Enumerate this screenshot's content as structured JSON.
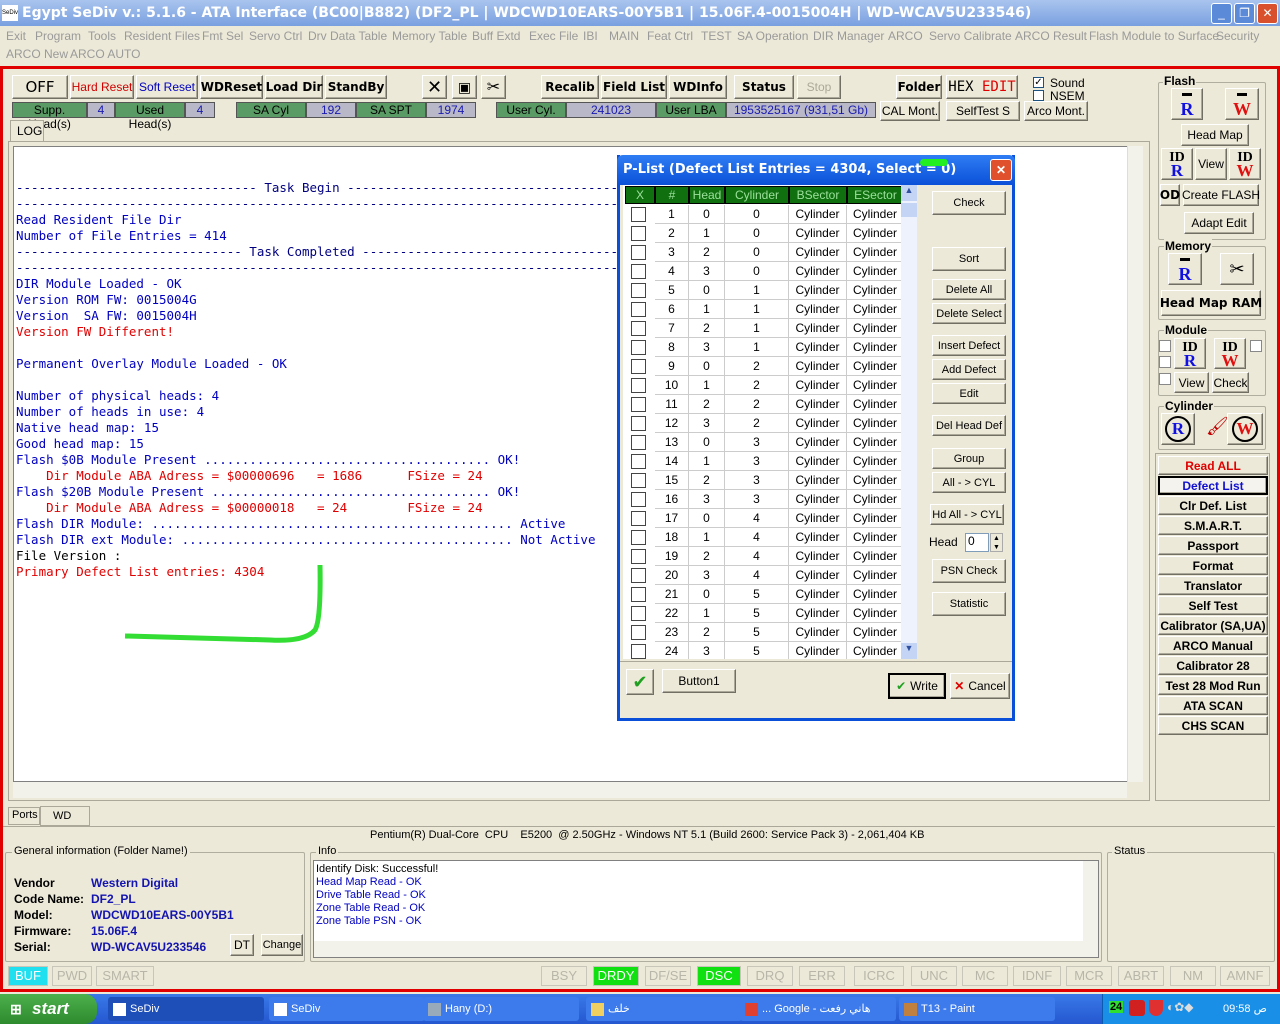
{
  "window": {
    "title": "Egypt  SeDiv v.: 5.1.6 - ATA Interface (BC00|B882)  (DF2_PL  |  WDCWD10EARS-00Y5B1  |  15.06F.4-0015004H  |  WD-WCAV5U233546)",
    "logo": "SeDiv"
  },
  "menu": [
    "Exit",
    "Program",
    "Tools",
    "Resident Files",
    "Fmt Sel",
    "Servo Ctrl",
    "Drv Data Table",
    "Memory Table",
    "Buff Extd",
    "Exec File",
    "IBI",
    "MAIN",
    "Feat Ctrl",
    "TEST",
    "SA Operation",
    "DIR Manager",
    "ARCO",
    "Servo Calibrate",
    "ARCO Result",
    "Flash Module to Surface",
    "Security",
    "ARCO New",
    "ARCO AUTO"
  ],
  "toolbar": {
    "off": "OFF",
    "hard_reset": "Hard Reset",
    "soft_reset": "Soft Reset",
    "wdreset": "WDReset",
    "load_dir": "Load Dir",
    "standby": "StandBy",
    "recalib": "Recalib",
    "field_list": "Field List",
    "wdinfo": "WDInfo",
    "status": "Status",
    "stop": "Stop",
    "folder": "Folder",
    "hex": "HEX",
    "edit": "EDIT",
    "sound": "Sound",
    "sound_checked": true,
    "nsem": "NSEM",
    "nsem_checked": false,
    "cal_mont": "CAL Mont.",
    "selftest_s": "SelfTest S",
    "arco_mont": "Arco Mont."
  },
  "info_bar": {
    "supp_heads_label": "Supp. Head(s)",
    "supp_heads": "4",
    "used_heads_label": "Used Head(s)",
    "used_heads": "4",
    "sa_cyl_label": "SA Cyl",
    "sa_cyl": "192",
    "sa_spt_label": "SA SPT",
    "sa_spt": "1974",
    "user_cyl_label": "User Cyl.",
    "user_cyl": "241023",
    "user_lba_label": "User LBA",
    "user_lba": "1953525167  (931,51 Gb)"
  },
  "log_tab": "LOG",
  "log": [
    {
      "t": "-------------------------------- Task Begin ---------------------------------------------------------------",
      "c": "#000080"
    },
    {
      "t": "-------------------------------------------------------------------------------------------------------------",
      "c": "#000080"
    },
    {
      "t": "Read Resident File Dir",
      "c": "#0000c0"
    },
    {
      "t": "Number of File Entries = 414",
      "c": "#0000c0"
    },
    {
      "t": "------------------------------ Task Completed -------------------------------------------------------------",
      "c": "#000080"
    },
    {
      "t": "-------------------------------------------------------------------------------------------------------------",
      "c": "#000080"
    },
    {
      "t": "DIR Module Loaded - OK",
      "c": "#0000c0"
    },
    {
      "t": "Version ROM FW: 0015004G",
      "c": "#0000c0"
    },
    {
      "t": "Version  SA FW: 0015004H",
      "c": "#0000c0"
    },
    {
      "t": "Version FW Different!",
      "c": "#e00000"
    },
    {
      "t": "",
      "c": "#000"
    },
    {
      "t": "Permanent Overlay Module Loaded - OK",
      "c": "#0000c0"
    },
    {
      "t": "",
      "c": "#000"
    },
    {
      "t": "Number of physical heads: 4",
      "c": "#0000c0"
    },
    {
      "t": "Number of heads in use: 4",
      "c": "#0000c0"
    },
    {
      "t": "Native head map: 15",
      "c": "#0000c0"
    },
    {
      "t": "Good head map: 15",
      "c": "#0000c0"
    },
    {
      "t": "Flash $0B Module Present ...................................... OK!",
      "c": "#0000c0"
    },
    {
      "t": "    Dir Module ABA Adress = $00000696   = 1686      FSize = 24",
      "c": "#e00000"
    },
    {
      "t": "Flash $20B Module Present ..................................... OK!",
      "c": "#0000c0"
    },
    {
      "t": "    Dir Module ABA Adress = $00000018   = 24        FSize = 24",
      "c": "#e00000"
    },
    {
      "t": "Flash DIR Module: ................................................ Active",
      "c": "#0000c0"
    },
    {
      "t": "Flash DIR ext Module: ............................................ Not Active",
      "c": "#0000c0"
    },
    {
      "t": "File Version :",
      "c": "#000000"
    },
    {
      "t": "Primary Defect List entries: 4304",
      "c": "#e00000"
    }
  ],
  "dialog": {
    "title": "P-List (Defect List Entries = 4304, Select = 0)",
    "columns": [
      "X",
      "#",
      "Head",
      "Cylinder",
      "BSector",
      "ESector"
    ],
    "rows": [],
    "buttons": [
      "Check",
      "Sort",
      "Delete All",
      "Delete Select",
      "Insert Defect",
      "Add Defect",
      "Edit",
      "Del Head Def",
      "Group",
      "All - > CYL",
      "Hd All - > CYL",
      "PSN Check",
      "Statistic"
    ],
    "head_label": "Head",
    "head_value": "0",
    "button1": "Button1",
    "write": "Write",
    "cancel": "Cancel"
  },
  "right_panel": {
    "flash_label": "Flash",
    "head_map": "Head Map",
    "view": "View",
    "od": "OD",
    "create_flash": "Create FLASH",
    "adapt_edit": "Adapt Edit",
    "memory_label": "Memory",
    "head_map_ram": "Head Map RAM",
    "module_label": "Module",
    "module_view": "View",
    "module_check": "Check",
    "cylinder_label": "Cylinder",
    "id": "ID",
    "r": "R",
    "w": "W",
    "buttons": [
      "Read ALL",
      "Defect List",
      "Clr Def. List",
      "S.M.A.R.T.",
      "Passport",
      "Format",
      "Translator",
      "Self Test",
      "Calibrator (SA,UA)",
      "ARCO Manual",
      "Calibrator 28",
      "Test 28 Mod Run",
      "ATA SCAN",
      "CHS SCAN"
    ],
    "selected": "Defect List"
  },
  "bottom_tabs": [
    "Ports",
    "WD"
  ],
  "sysinfo": "Pentium(R) Dual-Core  CPU    E5200  @ 2.50GHz - Windows NT 5.1 (Build 2600: Service Pack 3) - 2,061,404 KB",
  "general": {
    "title": "General information (Folder Name!)",
    "fields": [
      {
        "k": "Vendor",
        "v": "Western Digital"
      },
      {
        "k": "Code Name:",
        "v": "DF2_PL"
      },
      {
        "k": "Model:",
        "v": "WDCWD10EARS-00Y5B1"
      },
      {
        "k": "Firmware:",
        "v": "15.06F.4"
      },
      {
        "k": "Serial:",
        "v": "WD-WCAV5U233546"
      }
    ],
    "dt": "DT",
    "change": "Change"
  },
  "info": {
    "title": "Info",
    "lines": [
      {
        "t": "Identify Disk: Successful!",
        "c": "#000000"
      },
      {
        "t": "Head Map Read - OK",
        "c": "#0000c0"
      },
      {
        "t": "Drive Table Read - OK",
        "c": "#0000c0"
      },
      {
        "t": "Zone Table Read - OK",
        "c": "#0000c0"
      },
      {
        "t": "Zone Table PSN - OK",
        "c": "#0000c0"
      }
    ]
  },
  "status_title": "Status",
  "indicators_left": [
    {
      "l": "BUF",
      "on": "#20e0f0"
    },
    {
      "l": "PWD",
      "on": null
    },
    {
      "l": "SMART",
      "on": null
    }
  ],
  "indicators_right": [
    {
      "l": "BSY",
      "on": null
    },
    {
      "l": "DRDY",
      "on": "#10e010"
    },
    {
      "l": "DF/SE",
      "on": null
    },
    {
      "l": "DSC",
      "on": "#10e010"
    },
    {
      "l": "DRQ",
      "on": null
    },
    {
      "l": "ERR",
      "on": null
    },
    {
      "l": "ICRC",
      "on": null
    },
    {
      "l": "UNC",
      "on": null
    },
    {
      "l": "MC",
      "on": null
    },
    {
      "l": "IDNF",
      "on": null
    },
    {
      "l": "MCR",
      "on": null
    },
    {
      "l": "ABRT",
      "on": null
    },
    {
      "l": "NM",
      "on": null
    },
    {
      "l": "AMNF",
      "on": null
    }
  ],
  "taskbar": {
    "start": "start",
    "items": [
      "SeDiv",
      "SeDiv",
      "Hany (D:)",
      "خلف",
      "... Google - هاني رفعت",
      "T13 - Paint"
    ],
    "clock": "09:58 ص",
    "tray_num": "24"
  }
}
